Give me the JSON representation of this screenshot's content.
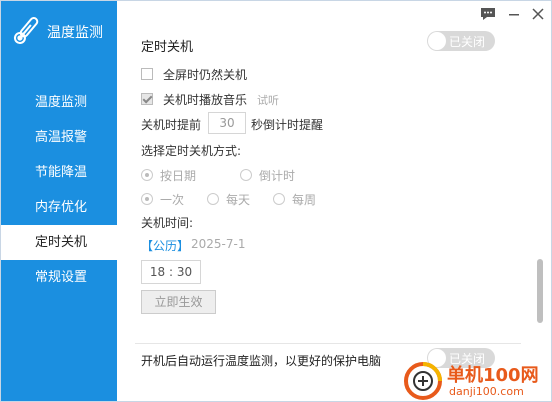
{
  "app": {
    "title": "温度监测"
  },
  "sidebar": {
    "items": [
      {
        "label": "温度监测",
        "active": false
      },
      {
        "label": "高温报警",
        "active": false
      },
      {
        "label": "节能降温",
        "active": false
      },
      {
        "label": "内存优化",
        "active": false
      },
      {
        "label": "定时关机",
        "active": true
      },
      {
        "label": "常规设置",
        "active": false
      }
    ]
  },
  "section": {
    "title": "定时关机",
    "toggle_label": "已关闭",
    "fullscreen_label": "全屏时仍然关机",
    "music_label": "关机时播放音乐",
    "music_link": "试听",
    "remind_prefix": "关机时提前",
    "remind_value": "30",
    "remind_suffix": "秒倒计时提醒",
    "mode_title": "选择定时关机方式:",
    "mode_date": "按日期",
    "mode_countdown": "倒计时",
    "freq_once": "一次",
    "freq_daily": "每天",
    "freq_weekly": "每周",
    "time_title": "关机时间:",
    "calendar_tag": "【公历】",
    "date_value": "2025-7-1",
    "hour": "18",
    "colon": ":",
    "minute": "30",
    "apply_button": "立即生效"
  },
  "autostart": {
    "label": "开机后自动运行温度监测，以更好的保护电脑",
    "toggle_label": "已关闭"
  },
  "watermark": {
    "brand": "单机100网",
    "url": "danji100.com"
  },
  "colors": {
    "sidebar": "#1b8fe0",
    "accent": "#1b8fe0",
    "toggle_off": "#d9d9d9"
  }
}
